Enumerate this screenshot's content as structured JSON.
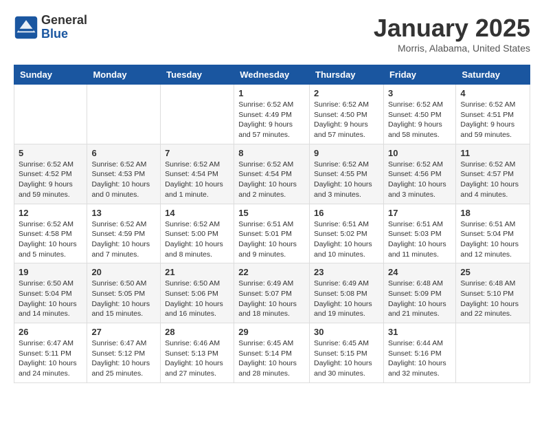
{
  "header": {
    "logo_general": "General",
    "logo_blue": "Blue",
    "month_title": "January 2025",
    "location": "Morris, Alabama, United States"
  },
  "weekdays": [
    "Sunday",
    "Monday",
    "Tuesday",
    "Wednesday",
    "Thursday",
    "Friday",
    "Saturday"
  ],
  "weeks": [
    [
      {
        "day": "",
        "info": ""
      },
      {
        "day": "",
        "info": ""
      },
      {
        "day": "",
        "info": ""
      },
      {
        "day": "1",
        "info": "Sunrise: 6:52 AM\nSunset: 4:49 PM\nDaylight: 9 hours\nand 57 minutes."
      },
      {
        "day": "2",
        "info": "Sunrise: 6:52 AM\nSunset: 4:50 PM\nDaylight: 9 hours\nand 57 minutes."
      },
      {
        "day": "3",
        "info": "Sunrise: 6:52 AM\nSunset: 4:50 PM\nDaylight: 9 hours\nand 58 minutes."
      },
      {
        "day": "4",
        "info": "Sunrise: 6:52 AM\nSunset: 4:51 PM\nDaylight: 9 hours\nand 59 minutes."
      }
    ],
    [
      {
        "day": "5",
        "info": "Sunrise: 6:52 AM\nSunset: 4:52 PM\nDaylight: 9 hours\nand 59 minutes."
      },
      {
        "day": "6",
        "info": "Sunrise: 6:52 AM\nSunset: 4:53 PM\nDaylight: 10 hours\nand 0 minutes."
      },
      {
        "day": "7",
        "info": "Sunrise: 6:52 AM\nSunset: 4:54 PM\nDaylight: 10 hours\nand 1 minute."
      },
      {
        "day": "8",
        "info": "Sunrise: 6:52 AM\nSunset: 4:54 PM\nDaylight: 10 hours\nand 2 minutes."
      },
      {
        "day": "9",
        "info": "Sunrise: 6:52 AM\nSunset: 4:55 PM\nDaylight: 10 hours\nand 3 minutes."
      },
      {
        "day": "10",
        "info": "Sunrise: 6:52 AM\nSunset: 4:56 PM\nDaylight: 10 hours\nand 3 minutes."
      },
      {
        "day": "11",
        "info": "Sunrise: 6:52 AM\nSunset: 4:57 PM\nDaylight: 10 hours\nand 4 minutes."
      }
    ],
    [
      {
        "day": "12",
        "info": "Sunrise: 6:52 AM\nSunset: 4:58 PM\nDaylight: 10 hours\nand 5 minutes."
      },
      {
        "day": "13",
        "info": "Sunrise: 6:52 AM\nSunset: 4:59 PM\nDaylight: 10 hours\nand 7 minutes."
      },
      {
        "day": "14",
        "info": "Sunrise: 6:52 AM\nSunset: 5:00 PM\nDaylight: 10 hours\nand 8 minutes."
      },
      {
        "day": "15",
        "info": "Sunrise: 6:51 AM\nSunset: 5:01 PM\nDaylight: 10 hours\nand 9 minutes."
      },
      {
        "day": "16",
        "info": "Sunrise: 6:51 AM\nSunset: 5:02 PM\nDaylight: 10 hours\nand 10 minutes."
      },
      {
        "day": "17",
        "info": "Sunrise: 6:51 AM\nSunset: 5:03 PM\nDaylight: 10 hours\nand 11 minutes."
      },
      {
        "day": "18",
        "info": "Sunrise: 6:51 AM\nSunset: 5:04 PM\nDaylight: 10 hours\nand 12 minutes."
      }
    ],
    [
      {
        "day": "19",
        "info": "Sunrise: 6:50 AM\nSunset: 5:04 PM\nDaylight: 10 hours\nand 14 minutes."
      },
      {
        "day": "20",
        "info": "Sunrise: 6:50 AM\nSunset: 5:05 PM\nDaylight: 10 hours\nand 15 minutes."
      },
      {
        "day": "21",
        "info": "Sunrise: 6:50 AM\nSunset: 5:06 PM\nDaylight: 10 hours\nand 16 minutes."
      },
      {
        "day": "22",
        "info": "Sunrise: 6:49 AM\nSunset: 5:07 PM\nDaylight: 10 hours\nand 18 minutes."
      },
      {
        "day": "23",
        "info": "Sunrise: 6:49 AM\nSunset: 5:08 PM\nDaylight: 10 hours\nand 19 minutes."
      },
      {
        "day": "24",
        "info": "Sunrise: 6:48 AM\nSunset: 5:09 PM\nDaylight: 10 hours\nand 21 minutes."
      },
      {
        "day": "25",
        "info": "Sunrise: 6:48 AM\nSunset: 5:10 PM\nDaylight: 10 hours\nand 22 minutes."
      }
    ],
    [
      {
        "day": "26",
        "info": "Sunrise: 6:47 AM\nSunset: 5:11 PM\nDaylight: 10 hours\nand 24 minutes."
      },
      {
        "day": "27",
        "info": "Sunrise: 6:47 AM\nSunset: 5:12 PM\nDaylight: 10 hours\nand 25 minutes."
      },
      {
        "day": "28",
        "info": "Sunrise: 6:46 AM\nSunset: 5:13 PM\nDaylight: 10 hours\nand 27 minutes."
      },
      {
        "day": "29",
        "info": "Sunrise: 6:45 AM\nSunset: 5:14 PM\nDaylight: 10 hours\nand 28 minutes."
      },
      {
        "day": "30",
        "info": "Sunrise: 6:45 AM\nSunset: 5:15 PM\nDaylight: 10 hours\nand 30 minutes."
      },
      {
        "day": "31",
        "info": "Sunrise: 6:44 AM\nSunset: 5:16 PM\nDaylight: 10 hours\nand 32 minutes."
      },
      {
        "day": "",
        "info": ""
      }
    ]
  ]
}
